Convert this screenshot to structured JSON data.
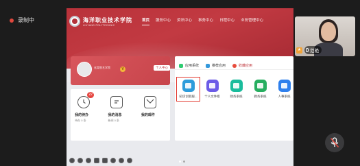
{
  "recording": {
    "label": "录制中"
  },
  "portal": {
    "logo_text": "海洋职业技术学院",
    "logo_subtext": "LIUYANG POLYTECHNIC",
    "nav": [
      "首页",
      "服务中心",
      "资讯中心",
      "事务中心",
      "日程中心",
      "业务管理中心"
    ],
    "user": {
      "school": "化育智艺学院",
      "vip": "V",
      "personal_center_button": "个人中心"
    },
    "stats": [
      {
        "title": "我的待办",
        "sub": "待办 0 条",
        "badge": "22"
      },
      {
        "title": "我的消息",
        "sub": "新闻 0 条",
        "badge": ""
      },
      {
        "title": "我的邮件",
        "sub": "",
        "badge": ""
      }
    ],
    "app_tabs": [
      "应用系统",
      "推荐应用",
      "收藏应用"
    ],
    "apps": [
      {
        "label": "知识创新服...",
        "color": "#2d9cdb"
      },
      {
        "label": "个人文件柜",
        "color": "#6c5ce7"
      },
      {
        "label": "财务系统",
        "color": "#1abc9c"
      },
      {
        "label": "教务系统",
        "color": "#27ae60"
      },
      {
        "label": "人事系统",
        "color": "#2f80ed"
      }
    ]
  },
  "participant": {
    "name": "范艳",
    "host_icon": "host-icon"
  },
  "colors": {
    "brand_red": "#b9323a",
    "highlight_box": "#e3382f",
    "record_dot": "#e0483d"
  }
}
